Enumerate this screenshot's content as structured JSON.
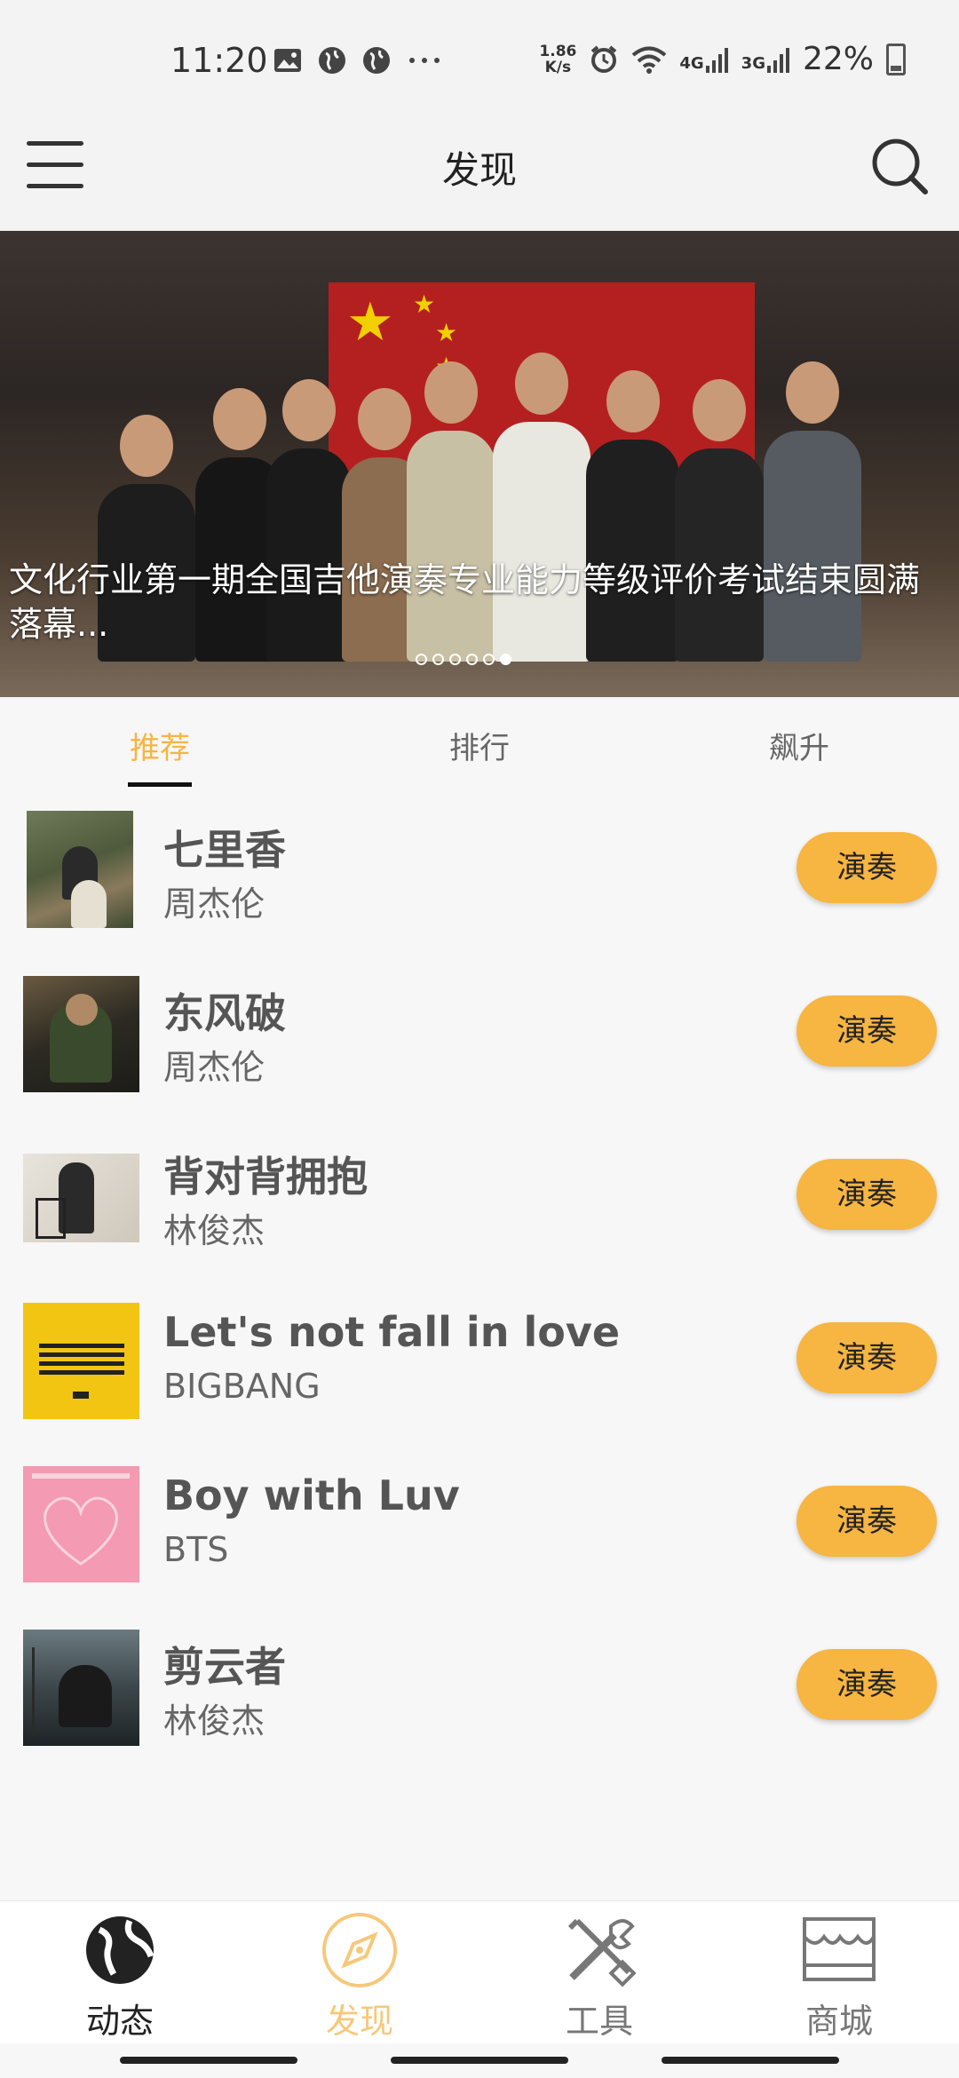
{
  "status_bar": {
    "time": "11:20",
    "speed_top": "1.86",
    "speed_bottom": "K/s",
    "net1": "4G",
    "net2": "3G",
    "battery": "22%",
    "left_icons": [
      "image-icon",
      "globe-icon",
      "globe-icon",
      "more-icon"
    ],
    "right_icons": [
      "alarm-icon",
      "wifi-icon",
      "signal-icon",
      "signal-icon",
      "battery-icon"
    ]
  },
  "header": {
    "title": "发现",
    "menu_icon": "hamburger-menu-icon",
    "search_icon": "search-icon"
  },
  "banner": {
    "caption": "文化行业第一期全国吉他演奏专业能力等级评价考试结束圆满落幕...",
    "slide_count": 6,
    "active_slide": 6
  },
  "tabs": [
    {
      "label": "推荐",
      "active": true
    },
    {
      "label": "排行",
      "active": false
    },
    {
      "label": "飙升",
      "active": false
    }
  ],
  "songs": [
    {
      "title": "七里香",
      "artist": "周杰伦",
      "action": "演奏"
    },
    {
      "title": "东风破",
      "artist": "周杰伦",
      "action": "演奏"
    },
    {
      "title": "背对背拥抱",
      "artist": "林俊杰",
      "action": "演奏"
    },
    {
      "title": "Let's not fall in love",
      "artist": "BIGBANG",
      "action": "演奏"
    },
    {
      "title": "Boy with Luv",
      "artist": "BTS",
      "action": "演奏"
    },
    {
      "title": "剪云者",
      "artist": "林俊杰",
      "action": "演奏"
    }
  ],
  "bottom_nav": [
    {
      "label": "动态",
      "icon": "globe-icon",
      "active": false
    },
    {
      "label": "发现",
      "icon": "compass-icon",
      "active": true
    },
    {
      "label": "工具",
      "icon": "tools-icon",
      "active": false
    },
    {
      "label": "商城",
      "icon": "store-icon",
      "active": false
    }
  ],
  "colors": {
    "accent": "#f7b541",
    "accent_light": "#f7c87a",
    "background": "#f7f7f7",
    "header_bg": "#f3f3f3"
  }
}
